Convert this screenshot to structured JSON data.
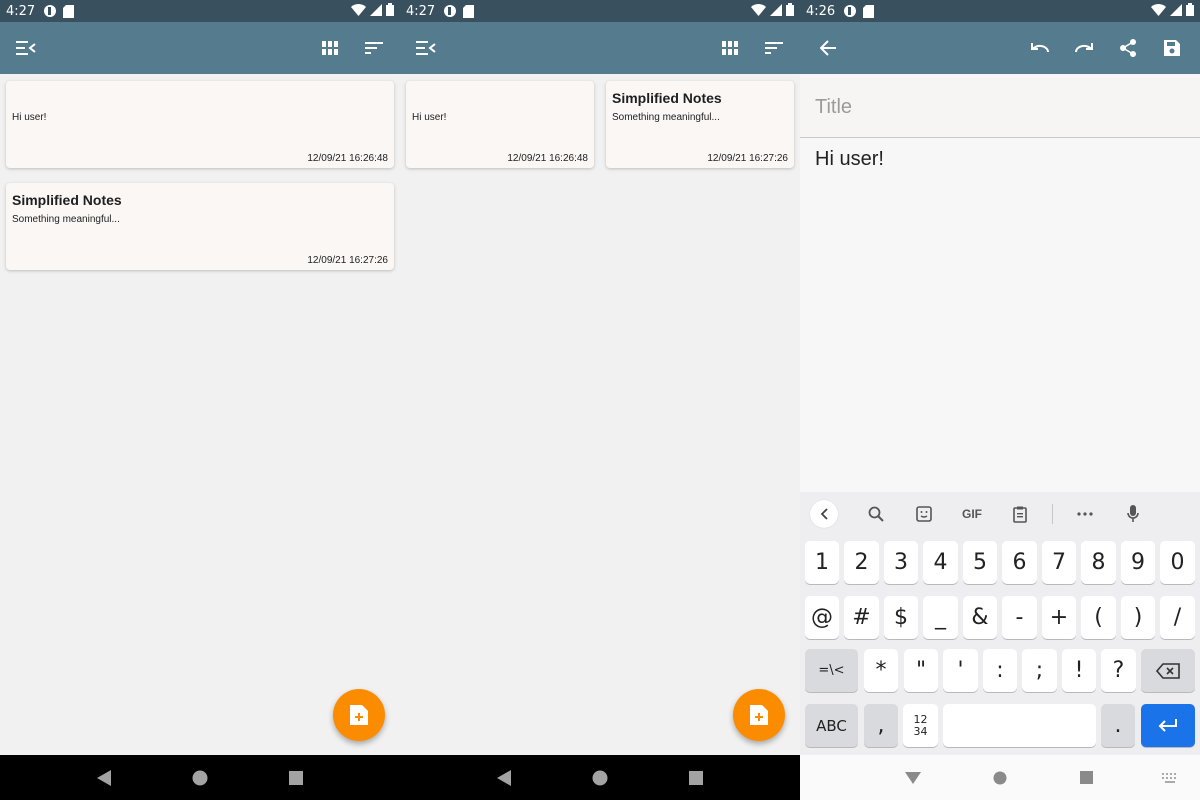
{
  "status": {
    "time_list": "4:27",
    "time_editor": "4:26"
  },
  "list_cards": [
    {
      "title": "",
      "body": "Hi user!",
      "date": "12/09/21 16:26:48"
    },
    {
      "title": "Simplified Notes",
      "body": "Something meaningful...",
      "date": "12/09/21 16:27:26"
    }
  ],
  "editor": {
    "title_placeholder": "Title",
    "title_value": "",
    "body_text": "Hi user!"
  },
  "keyboard": {
    "tools": [
      "search",
      "sticker",
      "GIF",
      "clipboard",
      "more",
      "mic"
    ],
    "gif_label": "GIF",
    "row1": [
      "1",
      "2",
      "3",
      "4",
      "5",
      "6",
      "7",
      "8",
      "9",
      "0"
    ],
    "row2": [
      "@",
      "#",
      "$",
      "_",
      "&",
      "-",
      "+",
      "(",
      ")",
      "/"
    ],
    "row3_left": "=\\<",
    "row3": [
      "*",
      "\"",
      "'",
      ":",
      ";",
      "!",
      "?"
    ],
    "abc_label": "ABC",
    "comma": ",",
    "numpad_label_top": "12",
    "numpad_label_bottom": "34",
    "period": "."
  },
  "colors": {
    "statusbar": "#39515f",
    "appbar": "#557b8f",
    "fab": "#fb8c00",
    "enter": "#1a73e8"
  }
}
